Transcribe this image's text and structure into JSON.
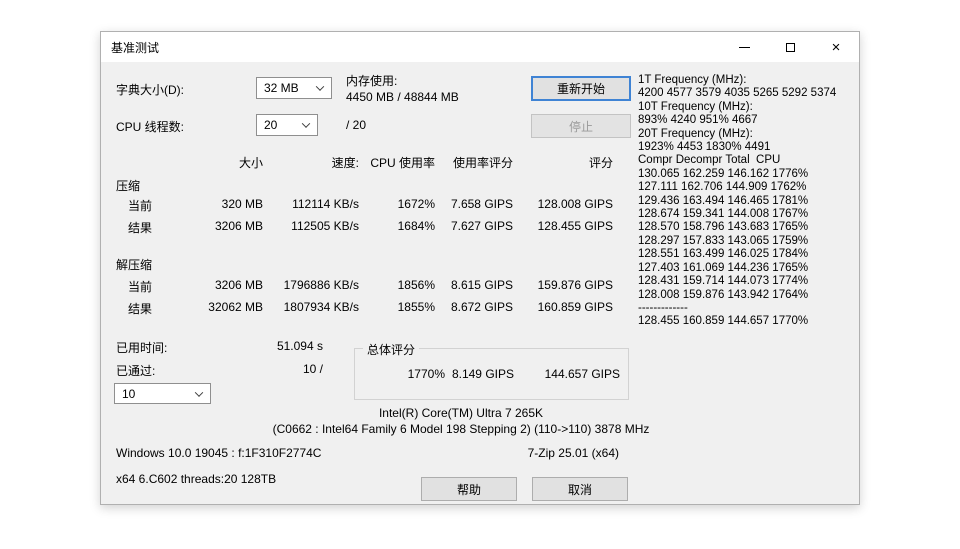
{
  "window": {
    "title": "基准测试",
    "close_glyph": "×"
  },
  "controls": {
    "dictionary_label": "字典大小(D):",
    "dictionary_value": "32 MB",
    "memory_label": "内存使用:",
    "memory_value": "4450 MB / 48844 MB",
    "threads_label": "CPU 线程数:",
    "threads_value": "20",
    "threads_suffix": "/ 20",
    "restart_button": "重新开始",
    "stop_button": "停止"
  },
  "table": {
    "headers": {
      "size": "大小",
      "speed": "速度:",
      "cpu_usage": "CPU 使用率",
      "usage_rating": "使用率评分",
      "rating": "评分"
    },
    "compression": {
      "title": "压缩",
      "current": {
        "label": "当前",
        "size": "320 MB",
        "speed": "112114 KB/s",
        "cpu": "1672%",
        "usage_rating": "7.658 GIPS",
        "rating": "128.008 GIPS"
      },
      "result": {
        "label": "结果",
        "size": "3206 MB",
        "speed": "112505 KB/s",
        "cpu": "1684%",
        "usage_rating": "7.627 GIPS",
        "rating": "128.455 GIPS"
      }
    },
    "decompression": {
      "title": "解压缩",
      "current": {
        "label": "当前",
        "size": "3206 MB",
        "speed": "1796886 KB/s",
        "cpu": "1856%",
        "usage_rating": "8.615 GIPS",
        "rating": "159.876 GIPS"
      },
      "result": {
        "label": "结果",
        "size": "32062 MB",
        "speed": "1807934 KB/s",
        "cpu": "1855%",
        "usage_rating": "8.672 GIPS",
        "rating": "160.859 GIPS"
      }
    }
  },
  "summary": {
    "elapsed_label": "已用时间:",
    "elapsed_value": "51.094 s",
    "passes_label": "已通过:",
    "passes_value": "10 /",
    "passes_combo_value": "10",
    "total_group_title": "总体评分",
    "total_cpu": "1770%",
    "total_usage_rating": "8.149 GIPS",
    "total_rating": "144.657 GIPS"
  },
  "info": {
    "cpu_line1": "Intel(R) Core(TM) Ultra 7 265K",
    "cpu_line2": "(C0662 : Intel64 Family 6 Model 198 Stepping 2) (110->110) 3878 MHz",
    "windows_line": "Windows 10.0 19045 : f:1F310F2774C",
    "sevenzip_version": "7-Zip 25.01 (x64)",
    "system_line": "x64 6.C602 threads:20 128TB"
  },
  "buttons": {
    "help": "帮助",
    "cancel": "取消"
  },
  "log": {
    "lines": [
      "1T Frequency (MHz):",
      "4200 4577 3579 4035 5265 5292 5374",
      "10T Frequency (MHz):",
      "893% 4240 951% 4667",
      "20T Frequency (MHz):",
      "1923% 4453 1830% 4491",
      "Compr Decompr Total  CPU",
      "130.065 162.259 146.162 1776%",
      "127.111 162.706 144.909 1762%",
      "129.436 163.494 146.465 1781%",
      "128.674 159.341 144.008 1767%",
      "128.570 158.796 143.683 1765%",
      "128.297 157.833 143.065 1759%",
      "128.551 163.499 146.025 1784%",
      "127.403 161.069 144.236 1765%",
      "128.431 159.714 144.073 1774%",
      "128.008 159.876 143.942 1764%",
      "-------------",
      "128.455 160.859 144.657 1770%"
    ]
  }
}
